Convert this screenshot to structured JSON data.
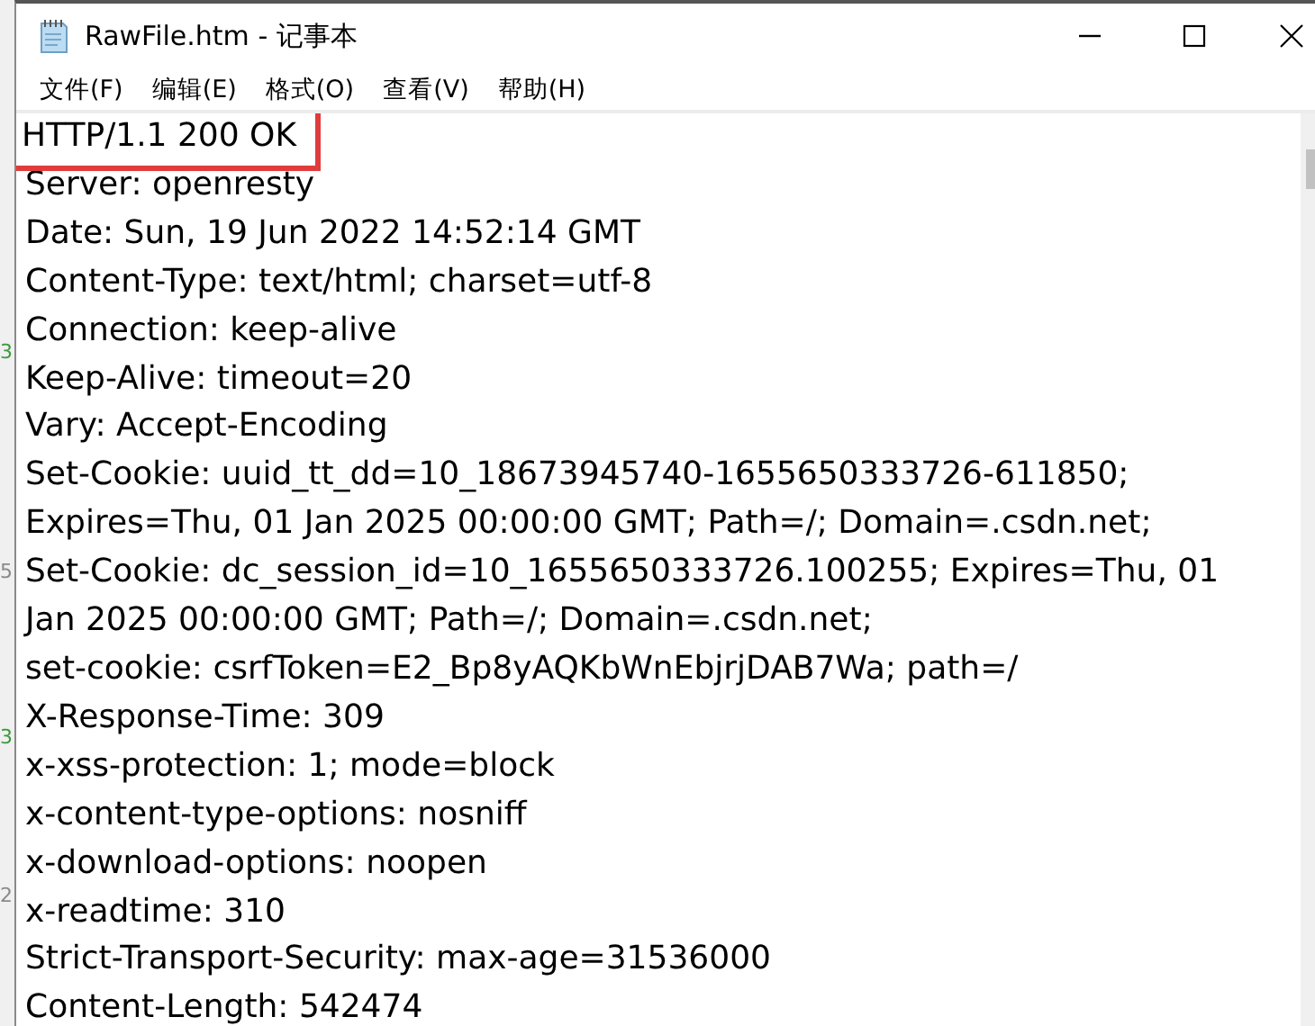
{
  "window": {
    "title": "RawFile.htm - 记事本"
  },
  "menu": [
    "文件(F)",
    "编辑(E)",
    "格式(O)",
    "查看(V)",
    "帮助(H)"
  ],
  "lines": [
    {
      "text": "HTTP/1.1 200 OK",
      "annotated": true
    },
    {
      "text": "Server: openresty",
      "annotated": false
    },
    {
      "text": "Date: Sun, 19 Jun 2022 14:52:14 GMT",
      "annotated": false
    },
    {
      "text": "Content-Type: text/html; charset=utf-8",
      "annotated": false
    },
    {
      "text": "Connection: keep-alive",
      "annotated": false
    },
    {
      "text": "Keep-Alive: timeout=20",
      "annotated": false
    },
    {
      "text": "Vary: Accept-Encoding",
      "annotated": false
    },
    {
      "text": "Set-Cookie: uuid_tt_dd=10_18673945740-1655650333726-611850;",
      "annotated": false
    },
    {
      "text": "Expires=Thu, 01 Jan 2025 00:00:00 GMT; Path=/; Domain=.csdn.net;",
      "annotated": false
    },
    {
      "text": "Set-Cookie: dc_session_id=10_1655650333726.100255; Expires=Thu, 01",
      "annotated": false
    },
    {
      "text": "Jan 2025 00:00:00 GMT; Path=/; Domain=.csdn.net;",
      "annotated": false
    },
    {
      "text": "set-cookie: csrfToken=E2_Bp8yAQKbWnEbjrjDAB7Wa; path=/",
      "annotated": false
    },
    {
      "text": "X-Response-Time: 309",
      "annotated": false
    },
    {
      "text": "x-xss-protection: 1; mode=block",
      "annotated": false
    },
    {
      "text": "x-content-type-options: nosniff",
      "annotated": false
    },
    {
      "text": "x-download-options: noopen",
      "annotated": false
    },
    {
      "text": "x-readtime: 310",
      "annotated": false
    },
    {
      "text": "Strict-Transport-Security: max-age=31536000",
      "annotated": false
    },
    {
      "text": "Content-Length: 542474",
      "annotated": false
    }
  ],
  "background_window": {
    "marks": [
      {
        "text": "3",
        "color": "#3c9a3c"
      },
      {
        "text": "5",
        "color": "#8a8a8a"
      },
      {
        "text": "3",
        "color": "#3c9a3c"
      },
      {
        "text": "2",
        "color": "#8a8a8a"
      }
    ]
  }
}
